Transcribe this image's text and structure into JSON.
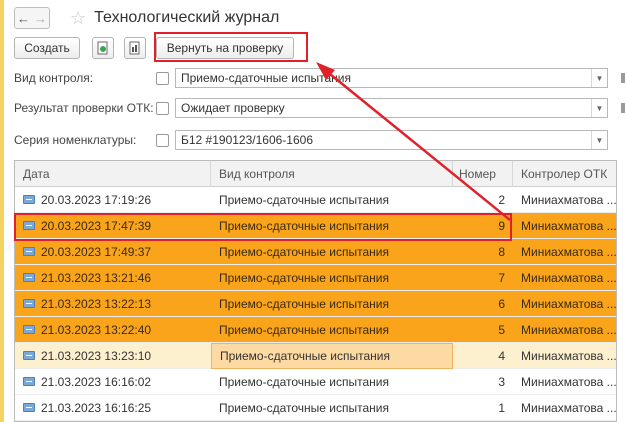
{
  "window": {
    "title": "Технологический журнал",
    "nav_back": "←",
    "nav_forward": "→"
  },
  "toolbar": {
    "create_label": "Создать",
    "return_label": "Вернуть на проверку"
  },
  "filters": [
    {
      "label": "Вид контроля:",
      "value": "Приемо-сдаточные испытания"
    },
    {
      "label": "Результат проверки ОТК:",
      "value": "Ожидает проверку"
    },
    {
      "label": "Серия номенклатуры:",
      "value": "Б12 #190123/1606-1606"
    }
  ],
  "table": {
    "columns": [
      "Дата",
      "Вид контроля",
      "Номер",
      "Контролер ОТК"
    ],
    "rows": [
      {
        "date": "20.03.2023 17:19:26",
        "kind": "Приемо-сдаточные испытания",
        "num": "2",
        "controller": "Миниахматова ...",
        "style": "white"
      },
      {
        "date": "20.03.2023 17:47:39",
        "kind": "Приемо-сдаточные испытания",
        "num": "9",
        "controller": "Миниахматова ...",
        "style": "orange"
      },
      {
        "date": "20.03.2023 17:49:37",
        "kind": "Приемо-сдаточные испытания",
        "num": "8",
        "controller": "Миниахматова ...",
        "style": "orange"
      },
      {
        "date": "21.03.2023 13:21:46",
        "kind": "Приемо-сдаточные испытания",
        "num": "7",
        "controller": "Миниахматова ...",
        "style": "orange"
      },
      {
        "date": "21.03.2023 13:22:13",
        "kind": "Приемо-сдаточные испытания",
        "num": "6",
        "controller": "Миниахматова ...",
        "style": "orange"
      },
      {
        "date": "21.03.2023 13:22:40",
        "kind": "Приемо-сдаточные испытания",
        "num": "5",
        "controller": "Миниахматова ...",
        "style": "orange"
      },
      {
        "date": "21.03.2023 13:23:10",
        "kind": "Приемо-сдаточные испытания",
        "num": "4",
        "controller": "Миниахматова ...",
        "style": "light"
      },
      {
        "date": "21.03.2023 16:16:02",
        "kind": "Приемо-сдаточные испытания",
        "num": "3",
        "controller": "Миниахматова ...",
        "style": "white"
      },
      {
        "date": "21.03.2023 16:16:25",
        "kind": "Приемо-сдаточные испытания",
        "num": "1",
        "controller": "Миниахматова ...",
        "style": "white"
      }
    ]
  },
  "colors": {
    "highlight_red": "#e0212a",
    "row_orange": "#f9a41b",
    "row_current": "#fdf0cf"
  }
}
